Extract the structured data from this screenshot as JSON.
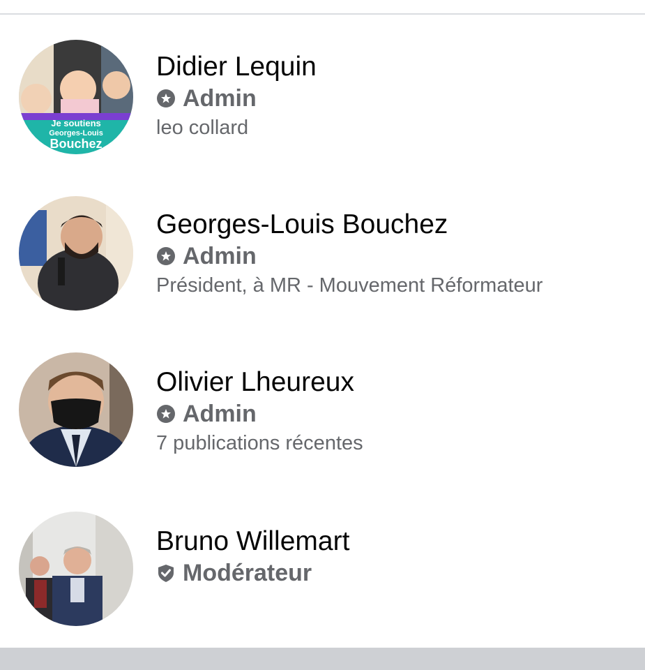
{
  "members": [
    {
      "name": "Didier Lequin",
      "role": "Admin",
      "role_icon": "admin-badge-icon",
      "subtitle": "leo collard",
      "avatar_text": [
        "Je soutiens",
        "Georges-Louis",
        "Bouchez"
      ]
    },
    {
      "name": "Georges-Louis Bouchez",
      "role": "Admin",
      "role_icon": "admin-badge-icon",
      "subtitle": "Président, à MR - Mouvement Réformateur"
    },
    {
      "name": "Olivier Lheureux",
      "role": "Admin",
      "role_icon": "admin-badge-icon",
      "subtitle": "7 publications récentes"
    },
    {
      "name": "Bruno Willemart",
      "role": "Modérateur",
      "role_icon": "moderator-badge-icon",
      "subtitle": ""
    }
  ],
  "colors": {
    "name_text": "#050505",
    "secondary_text": "#65676b",
    "divider": "#dadde1",
    "bottom_bar": "#ced0d4"
  }
}
